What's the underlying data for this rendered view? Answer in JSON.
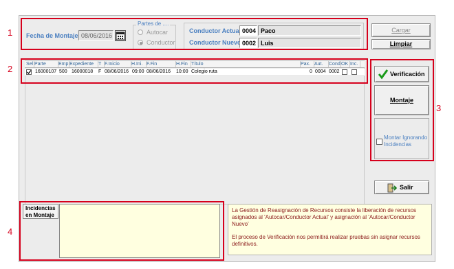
{
  "markers": [
    "1",
    "2",
    "3",
    "4"
  ],
  "header": {
    "fecha_label": "Fecha de Montaje",
    "fecha_value": "08/06/2016",
    "partes_title": "Partes de ....",
    "radio_autocar": "Autocar",
    "radio_conductor": "Conductor",
    "conductor_actual_label": "Conductor Actual",
    "conductor_actual_code": "0004",
    "conductor_actual_name": "Paco",
    "conductor_nuevo_label": "Conductor Nuevo",
    "conductor_nuevo_code": "0002",
    "conductor_nuevo_name": "Luis",
    "cargar": "Cargar",
    "limpiar": "Limpiar"
  },
  "grid": {
    "columns": [
      "Sel",
      "Parte",
      "Emp",
      "Expediente",
      "T",
      "F.Inicio",
      "H.Ini.",
      "F.Fin",
      "H.Fin",
      "Título",
      "Pax.",
      "Aut.",
      "Cond.",
      "OK",
      "Inc."
    ],
    "row": {
      "parte": "16000107",
      "emp": "500",
      "expediente": "16000018",
      "t": "F",
      "finicio": "08/06/2016",
      "hini": "09:00",
      "ffin": "08/06/2016",
      "hfin": "10:00",
      "titulo": "Colegio ruta",
      "pax": "0",
      "aut": "0004",
      "cond": "0002"
    }
  },
  "side": {
    "verificacion": "Verificación",
    "montaje": "Montaje",
    "montar_ignorando": "Montar Ignorando Incidencias",
    "salir": "Salir"
  },
  "incidencias_label": "Incidencias en Montaje",
  "info_p1": "La Gestión de Reasignación de Recursos consiste la liberación de recursos asignados al 'Autocar/Conductor Actual' y asignación al 'Autocar/Conductor Nuevo'",
  "info_p2": "El proceso de Verificación nos permitirá realizar pruebas sin asignar recursos definitivos.",
  "colors": {
    "annotation": "#d6001c",
    "label_blue": "#4a7fc0",
    "info_text": "#8b1a1a",
    "info_bg": "#ffffe0"
  }
}
